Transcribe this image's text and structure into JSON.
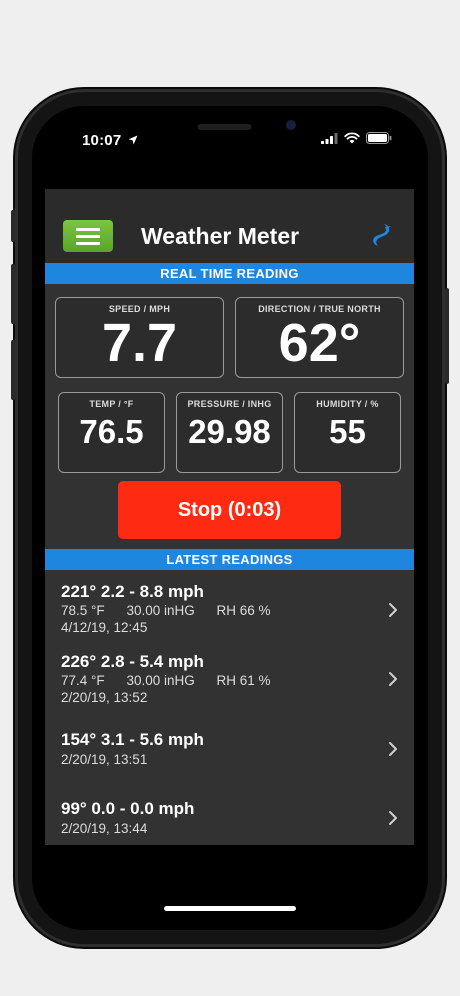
{
  "status": {
    "time": "10:07"
  },
  "app": {
    "title": "Weather Meter"
  },
  "realtime": {
    "section_label": "REAL TIME READING",
    "speed": {
      "label": "SPEED / MPH",
      "value": "7.7"
    },
    "direction": {
      "label": "DIRECTION / TRUE NORTH",
      "value": "62°"
    },
    "temp": {
      "label": "TEMP / °F",
      "value": "76.5"
    },
    "pressure": {
      "label": "PRESSURE / INHG",
      "value": "29.98"
    },
    "humidity": {
      "label": "HUMIDITY / %",
      "value": "55"
    }
  },
  "stop_button": {
    "label": "Stop (0:03)"
  },
  "latest": {
    "section_label": "LATEST READINGS",
    "readings": [
      {
        "title": "221° 2.2 - 8.8 mph",
        "temp": "78.5 °F",
        "pressure": "30.00 inHG",
        "rh": "RH 66 %",
        "datetime": "4/12/19, 12:45"
      },
      {
        "title": "226° 2.8 - 5.4 mph",
        "temp": "77.4 °F",
        "pressure": "30.00 inHG",
        "rh": "RH 61 %",
        "datetime": "2/20/19, 13:52"
      },
      {
        "title": "154° 3.1 - 5.6 mph",
        "datetime": "2/20/19, 13:51"
      },
      {
        "title": "99° 0.0 - 0.0 mph",
        "datetime": "2/20/19, 13:44"
      }
    ]
  },
  "colors": {
    "accent_blue": "#1f86e0",
    "stop_red": "#ff2a12",
    "menu_green": "#6bb838"
  },
  "icons": {
    "location": "location-arrow-icon",
    "signal": "cellular-signal-icon",
    "wifi": "wifi-icon",
    "battery": "battery-icon",
    "menu": "hamburger-menu-icon",
    "brand": "wind-logo-icon",
    "chevron": "chevron-right-icon"
  }
}
